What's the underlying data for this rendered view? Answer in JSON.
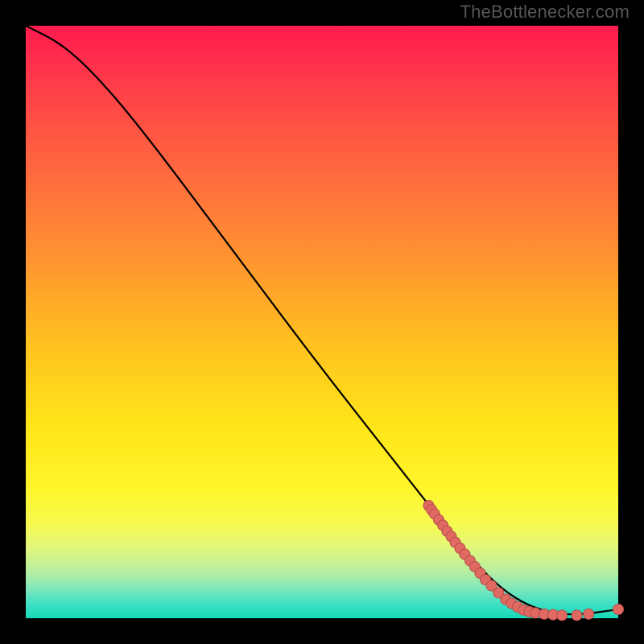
{
  "attribution": "TheBottlenecker.com",
  "chart_data": {
    "type": "line",
    "title": "",
    "xlabel": "",
    "ylabel": "",
    "xlim": [
      0,
      100
    ],
    "ylim": [
      0,
      100
    ],
    "curve": {
      "name": "bottleneck-curve",
      "points": [
        {
          "x": 0,
          "y": 100
        },
        {
          "x": 6,
          "y": 97
        },
        {
          "x": 12,
          "y": 91.5
        },
        {
          "x": 20,
          "y": 82
        },
        {
          "x": 35,
          "y": 62
        },
        {
          "x": 50,
          "y": 42
        },
        {
          "x": 65,
          "y": 23
        },
        {
          "x": 72,
          "y": 14
        },
        {
          "x": 78,
          "y": 7
        },
        {
          "x": 83,
          "y": 3
        },
        {
          "x": 88,
          "y": 1
        },
        {
          "x": 93,
          "y": 0.5
        },
        {
          "x": 100,
          "y": 1.5
        }
      ]
    },
    "markers": [
      {
        "x": 68.0,
        "y": 19.0
      },
      {
        "x": 68.5,
        "y": 18.3
      },
      {
        "x": 69.0,
        "y": 17.6
      },
      {
        "x": 69.7,
        "y": 16.6
      },
      {
        "x": 70.4,
        "y": 15.7
      },
      {
        "x": 71.1,
        "y": 14.7
      },
      {
        "x": 71.8,
        "y": 13.8
      },
      {
        "x": 72.5,
        "y": 12.8
      },
      {
        "x": 73.3,
        "y": 11.8
      },
      {
        "x": 74.1,
        "y": 10.8
      },
      {
        "x": 75.0,
        "y": 9.7
      },
      {
        "x": 75.8,
        "y": 8.7
      },
      {
        "x": 76.7,
        "y": 7.6
      },
      {
        "x": 77.6,
        "y": 6.5
      },
      {
        "x": 78.6,
        "y": 5.5
      },
      {
        "x": 79.8,
        "y": 4.3
      },
      {
        "x": 81.0,
        "y": 3.2
      },
      {
        "x": 82.0,
        "y": 2.5
      },
      {
        "x": 83.0,
        "y": 1.9
      },
      {
        "x": 84.0,
        "y": 1.4
      },
      {
        "x": 85.0,
        "y": 1.1
      },
      {
        "x": 86.0,
        "y": 0.9
      },
      {
        "x": 87.5,
        "y": 0.7
      },
      {
        "x": 89.0,
        "y": 0.6
      },
      {
        "x": 90.5,
        "y": 0.5
      },
      {
        "x": 93.0,
        "y": 0.5
      },
      {
        "x": 95.0,
        "y": 0.7
      },
      {
        "x": 100.0,
        "y": 1.5
      }
    ],
    "colors": {
      "curve": "#000000",
      "marker_fill": "#e06a62",
      "marker_stroke": "#b74d4a"
    }
  }
}
